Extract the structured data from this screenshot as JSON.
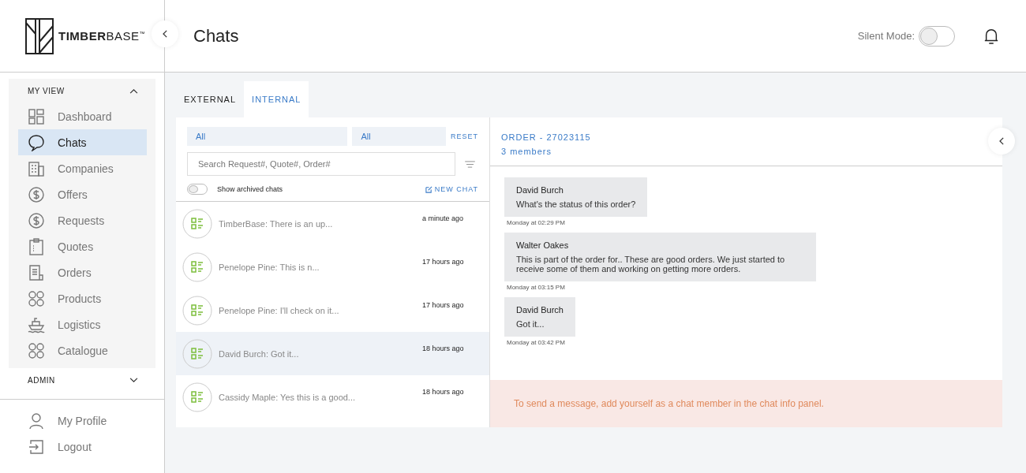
{
  "logo": "**TIMBER**BASE$^{™}$",
  "header": {
    "title": "Chats",
    "silent_mode": {
      "label": "Silent Mode:",
      "on": false
    }
  },
  "sidebar": {
    "sections": [
      {
        "title": "MY VIEW",
        "expanded": true,
        "items": [
          {
            "label": "Dashboard",
            "selected": false
          },
          {
            "label": "Chats",
            "selected": true
          },
          {
            "label": "Companies",
            "selected": false
          },
          {
            "label": "Offers",
            "selected": false
          },
          {
            "label": "Requests",
            "selected": false
          },
          {
            "label": "Quotes",
            "selected": false
          },
          {
            "label": "Orders",
            "selected": false
          },
          {
            "label": "Products",
            "selected": false
          },
          {
            "label": "Logistics",
            "selected": false
          },
          {
            "label": "Catalogue",
            "selected": false
          }
        ]
      },
      {
        "title": "ADMIN",
        "expanded": false
      }
    ],
    "footer": [
      {
        "label": "My Profile"
      },
      {
        "label": "Logout"
      }
    ]
  },
  "tabs": [
    {
      "label": "EXTERNAL",
      "selected": false
    },
    {
      "label": "INTERNAL",
      "selected": true
    }
  ],
  "filters": {
    "selects": [
      "All",
      "All"
    ],
    "reset": "RESET",
    "search": {
      "placeholder": "Search Request#, Quote#, Order#"
    },
    "archived": {
      "label": "Show archived chats",
      "on": false
    },
    "new_chat": "NEW CHAT"
  },
  "chats": [
    {
      "preview": "TimberBase: There is an up...",
      "time": "a minute ago",
      "selected": false
    },
    {
      "preview": "Penelope Pine: This is n...",
      "time": "17 hours ago",
      "selected": false
    },
    {
      "preview": "Penelope Pine: I'll check on it...",
      "time": "17 hours ago",
      "selected": false
    },
    {
      "preview": "David Burch: Got it...",
      "time": "18 hours ago",
      "selected": true
    },
    {
      "preview": "Cassidy Maple: Yes this is a good...",
      "time": "18 hours ago",
      "selected": false
    }
  ],
  "conversation": {
    "title": "ORDER - 27023115",
    "members": "3 members",
    "messages": [
      {
        "author": "David Burch",
        "text": "What's the status of this order?",
        "time": "Monday at 02:29 PM"
      },
      {
        "author": "Walter Oakes",
        "text": "This is part of the order for.. These are good orders. We just started to receive some of them and working on getting more orders.",
        "time": "Monday at 03:15 PM"
      },
      {
        "author": "David Burch",
        "text": "Got it...",
        "time": "Monday at 03:42 PM"
      }
    ],
    "notice": "To send a message, add yourself as a chat member in the chat info panel."
  }
}
